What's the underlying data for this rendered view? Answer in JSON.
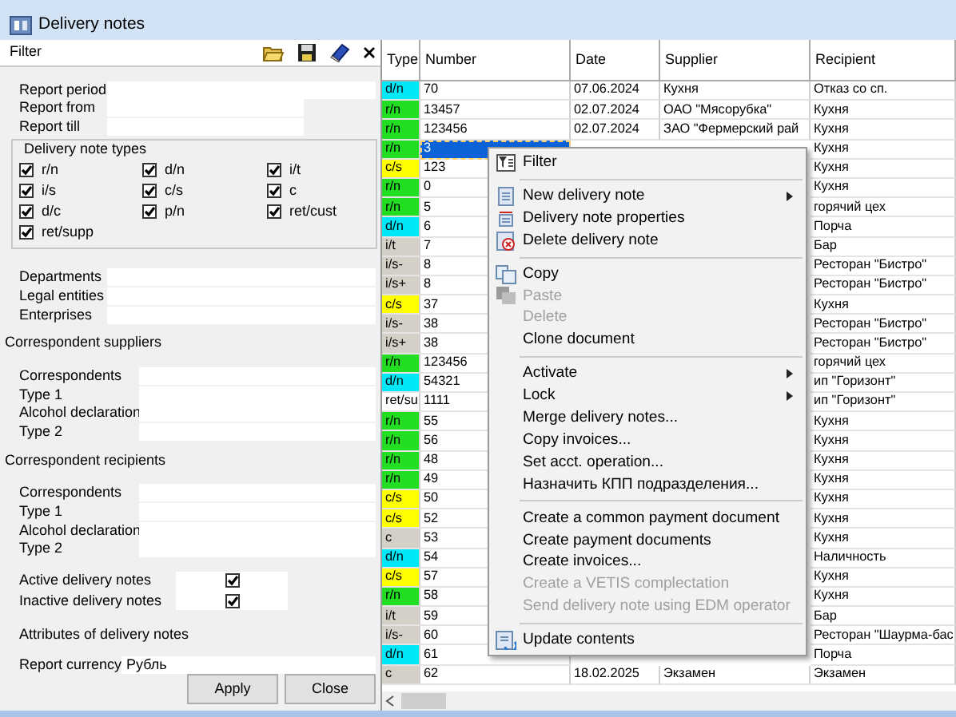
{
  "window": {
    "title": "Delivery notes"
  },
  "filter": {
    "title": "Filter",
    "period_fields": [
      {
        "label": "Report period",
        "kind": "long"
      },
      {
        "label": "Report from",
        "kind": "short"
      },
      {
        "label": "Report till",
        "kind": "short"
      }
    ],
    "types": {
      "title": "Delivery note types",
      "items": [
        {
          "label": "r/n",
          "checked": true
        },
        {
          "label": "d/n",
          "checked": true
        },
        {
          "label": "i/t",
          "checked": true
        },
        {
          "label": "i/s",
          "checked": true
        },
        {
          "label": "c/s",
          "checked": true
        },
        {
          "label": "c",
          "checked": true
        },
        {
          "label": "d/c",
          "checked": true
        },
        {
          "label": "p/n",
          "checked": true
        },
        {
          "label": "ret/cust",
          "checked": true
        },
        {
          "label": "ret/supp",
          "checked": true
        }
      ]
    },
    "org_fields": [
      {
        "label": "Departments"
      },
      {
        "label": "Legal entities"
      },
      {
        "label": "Enterprises"
      }
    ],
    "suppliers": {
      "title": "Correspondent suppliers",
      "fields": [
        {
          "label": "Correspondents"
        },
        {
          "label": "Type 1"
        },
        {
          "label": "Alcohol declaration"
        },
        {
          "label": "Type 2"
        }
      ]
    },
    "recipients": {
      "title": "Correspondent recipients",
      "fields": [
        {
          "label": "Correspondents"
        },
        {
          "label": "Type 1"
        },
        {
          "label": "Alcohol declaration"
        },
        {
          "label": "Type 2"
        }
      ]
    },
    "flags": [
      {
        "label": "Active delivery notes",
        "checked": true
      },
      {
        "label": "Inactive delivery notes",
        "checked": true
      }
    ],
    "attributes": {
      "title": "Attributes of delivery notes"
    },
    "currency": {
      "label": "Report currency",
      "value": "Рубль"
    },
    "buttons": [
      "Apply",
      "Close"
    ]
  },
  "table": {
    "columns": [
      "Type",
      "Number",
      "Date",
      "Supplier",
      "Recipient"
    ],
    "rows": [
      {
        "type": "d/n",
        "color": "#00e8f8",
        "number": "70",
        "date": "07.06.2024",
        "supplier": "Кухня",
        "recipient": "Отказ со сп.",
        "selected": false
      },
      {
        "type": "r/n",
        "color": "#22dd22",
        "number": "13457",
        "date": "02.07.2024",
        "supplier": "ОАО \"Мясорубка\"",
        "recipient": "Кухня",
        "selected": false
      },
      {
        "type": "r/n",
        "color": "#22dd22",
        "number": "123456",
        "date": "02.07.2024",
        "supplier": "ЗАО \"Фермерский рай",
        "recipient": "Кухня",
        "selected": false
      },
      {
        "type": "r/n",
        "color": "#22dd22",
        "number": "3",
        "recipient": "Кухня",
        "selected": true
      },
      {
        "type": "c/s",
        "color": "#ffff00",
        "number": "123",
        "recipient": "Кухня",
        "selected": false
      },
      {
        "type": "r/n",
        "color": "#22dd22",
        "number": "0",
        "recipient": "Кухня",
        "selected": false
      },
      {
        "type": "r/n",
        "color": "#22dd22",
        "number": "5",
        "recipient": "горячий цех",
        "selected": false
      },
      {
        "type": "d/n",
        "color": "#00e8f8",
        "number": "6",
        "recipient": "Порча",
        "selected": false
      },
      {
        "type": "i/t",
        "color": "#d4d0c8",
        "number": "7",
        "recipient": "Бар",
        "selected": false
      },
      {
        "type": "i/s-",
        "color": "#d4d0c8",
        "number": "8",
        "recipient": "Ресторан \"Бистро\"",
        "selected": false
      },
      {
        "type": "i/s+",
        "color": "#d4d0c8",
        "number": "8",
        "recipient": "Ресторан \"Бистро\"",
        "selected": false
      },
      {
        "type": "c/s",
        "color": "#ffff00",
        "number": "37",
        "recipient": "Кухня",
        "selected": false
      },
      {
        "type": "i/s-",
        "color": "#d4d0c8",
        "number": "38",
        "recipient": "Ресторан \"Бистро\"",
        "selected": false
      },
      {
        "type": "i/s+",
        "color": "#d4d0c8",
        "number": "38",
        "recipient": "Ресторан \"Бистро\"",
        "selected": false
      },
      {
        "type": "r/n",
        "color": "#22dd22",
        "number": "123456",
        "recipient": "горячий цех",
        "selected": false
      },
      {
        "type": "d/n",
        "color": "#00e8f8",
        "number": "54321",
        "recipient": "ип \"Горизонт\"",
        "selected": false
      },
      {
        "type": "ret/su",
        "color": "#ffffff",
        "number": "1111",
        "recipient": "ип \"Горизонт\"",
        "selected": false
      },
      {
        "type": "r/n",
        "color": "#22dd22",
        "number": "55",
        "recipient": "Кухня",
        "selected": false
      },
      {
        "type": "r/n",
        "color": "#22dd22",
        "number": "56",
        "recipient": "Кухня",
        "selected": false
      },
      {
        "type": "r/n",
        "color": "#22dd22",
        "number": "48",
        "recipient": "Кухня",
        "selected": false
      },
      {
        "type": "r/n",
        "color": "#22dd22",
        "number": "49",
        "recipient": "Кухня",
        "selected": false
      },
      {
        "type": "c/s",
        "color": "#ffff00",
        "number": "50",
        "recipient": "Кухня",
        "selected": false
      },
      {
        "type": "c/s",
        "color": "#ffff00",
        "number": "52",
        "recipient": "Кухня",
        "selected": false
      },
      {
        "type": "c",
        "color": "#d4d0c8",
        "number": "53",
        "recipient": "Кухня",
        "selected": false
      },
      {
        "type": "d/n",
        "color": "#00e8f8",
        "number": "54",
        "recipient": "Наличность",
        "selected": false
      },
      {
        "type": "c/s",
        "color": "#ffff00",
        "number": "57",
        "recipient": "Кухня",
        "selected": false
      },
      {
        "type": "r/n",
        "color": "#22dd22",
        "number": "58",
        "recipient": "Кухня",
        "selected": false
      },
      {
        "type": "i/t",
        "color": "#d4d0c8",
        "number": "59",
        "recipient": "Бар",
        "selected": false
      },
      {
        "type": "i/s-",
        "color": "#d4d0c8",
        "number": "60",
        "recipient": "Ресторан \"Шаурма-бас",
        "selected": false
      },
      {
        "type": "d/n",
        "color": "#00e8f8",
        "number": "61",
        "recipient": "Порча",
        "selected": false
      },
      {
        "type": "c",
        "color": "#d4d0c8",
        "number": "62",
        "date": "18.02.2025",
        "supplier": "Экзамен",
        "recipient": "Экзамен",
        "selected": false
      }
    ]
  },
  "context_menu": [
    {
      "kind": "item",
      "label": "Filter",
      "disabled": false
    },
    {
      "kind": "separator"
    },
    {
      "kind": "item",
      "label": "New delivery note",
      "disabled": false,
      "submenu": true
    },
    {
      "kind": "item",
      "label": "Delivery note properties",
      "disabled": false
    },
    {
      "kind": "item",
      "label": "Delete delivery note",
      "disabled": false
    },
    {
      "kind": "separator"
    },
    {
      "kind": "item",
      "label": "Copy",
      "disabled": false
    },
    {
      "kind": "item",
      "label": "Paste",
      "disabled": true
    },
    {
      "kind": "item",
      "label": "Delete",
      "disabled": true
    },
    {
      "kind": "item",
      "label": "Clone document",
      "disabled": false
    },
    {
      "kind": "separator"
    },
    {
      "kind": "item",
      "label": "Activate",
      "disabled": false,
      "submenu": true
    },
    {
      "kind": "item",
      "label": "Lock",
      "disabled": false,
      "submenu": true
    },
    {
      "kind": "item",
      "label": "Merge delivery notes...",
      "disabled": false
    },
    {
      "kind": "item",
      "label": "Copy invoices...",
      "disabled": false
    },
    {
      "kind": "item",
      "label": "Set acct. operation...",
      "disabled": false
    },
    {
      "kind": "item",
      "label": "Назначить КПП подразделения...",
      "disabled": false
    },
    {
      "kind": "separator"
    },
    {
      "kind": "item",
      "label": "Create a common payment document",
      "disabled": false
    },
    {
      "kind": "item",
      "label": "Create payment documents",
      "disabled": false
    },
    {
      "kind": "item",
      "label": "Create invoices...",
      "disabled": false
    },
    {
      "kind": "item",
      "label": "Create a VETIS complectation",
      "disabled": true
    },
    {
      "kind": "item",
      "label": "Send delivery note using EDM operator",
      "disabled": true
    },
    {
      "kind": "separator"
    },
    {
      "kind": "item",
      "label": "Update contents",
      "disabled": false
    }
  ]
}
